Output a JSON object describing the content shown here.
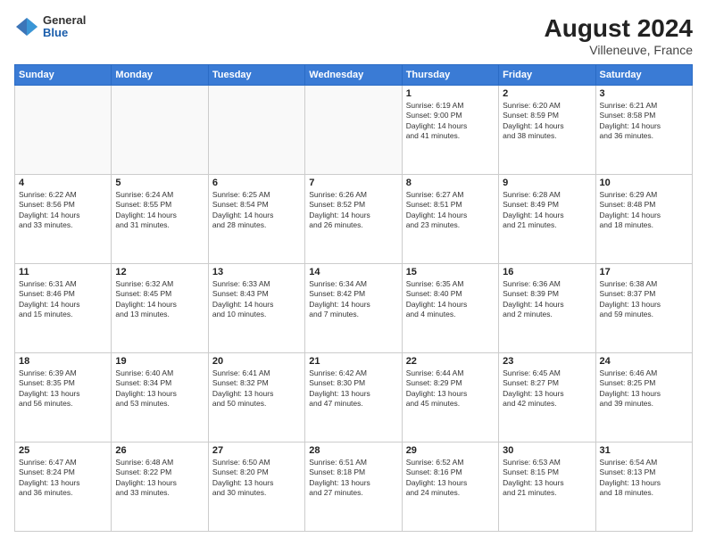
{
  "header": {
    "logo": {
      "general": "General",
      "blue": "Blue"
    },
    "title": "August 2024",
    "location": "Villeneuve, France"
  },
  "days_of_week": [
    "Sunday",
    "Monday",
    "Tuesday",
    "Wednesday",
    "Thursday",
    "Friday",
    "Saturday"
  ],
  "weeks": [
    [
      {
        "day": "",
        "info": ""
      },
      {
        "day": "",
        "info": ""
      },
      {
        "day": "",
        "info": ""
      },
      {
        "day": "",
        "info": ""
      },
      {
        "day": "1",
        "info": "Sunrise: 6:19 AM\nSunset: 9:00 PM\nDaylight: 14 hours\nand 41 minutes."
      },
      {
        "day": "2",
        "info": "Sunrise: 6:20 AM\nSunset: 8:59 PM\nDaylight: 14 hours\nand 38 minutes."
      },
      {
        "day": "3",
        "info": "Sunrise: 6:21 AM\nSunset: 8:58 PM\nDaylight: 14 hours\nand 36 minutes."
      }
    ],
    [
      {
        "day": "4",
        "info": "Sunrise: 6:22 AM\nSunset: 8:56 PM\nDaylight: 14 hours\nand 33 minutes."
      },
      {
        "day": "5",
        "info": "Sunrise: 6:24 AM\nSunset: 8:55 PM\nDaylight: 14 hours\nand 31 minutes."
      },
      {
        "day": "6",
        "info": "Sunrise: 6:25 AM\nSunset: 8:54 PM\nDaylight: 14 hours\nand 28 minutes."
      },
      {
        "day": "7",
        "info": "Sunrise: 6:26 AM\nSunset: 8:52 PM\nDaylight: 14 hours\nand 26 minutes."
      },
      {
        "day": "8",
        "info": "Sunrise: 6:27 AM\nSunset: 8:51 PM\nDaylight: 14 hours\nand 23 minutes."
      },
      {
        "day": "9",
        "info": "Sunrise: 6:28 AM\nSunset: 8:49 PM\nDaylight: 14 hours\nand 21 minutes."
      },
      {
        "day": "10",
        "info": "Sunrise: 6:29 AM\nSunset: 8:48 PM\nDaylight: 14 hours\nand 18 minutes."
      }
    ],
    [
      {
        "day": "11",
        "info": "Sunrise: 6:31 AM\nSunset: 8:46 PM\nDaylight: 14 hours\nand 15 minutes."
      },
      {
        "day": "12",
        "info": "Sunrise: 6:32 AM\nSunset: 8:45 PM\nDaylight: 14 hours\nand 13 minutes."
      },
      {
        "day": "13",
        "info": "Sunrise: 6:33 AM\nSunset: 8:43 PM\nDaylight: 14 hours\nand 10 minutes."
      },
      {
        "day": "14",
        "info": "Sunrise: 6:34 AM\nSunset: 8:42 PM\nDaylight: 14 hours\nand 7 minutes."
      },
      {
        "day": "15",
        "info": "Sunrise: 6:35 AM\nSunset: 8:40 PM\nDaylight: 14 hours\nand 4 minutes."
      },
      {
        "day": "16",
        "info": "Sunrise: 6:36 AM\nSunset: 8:39 PM\nDaylight: 14 hours\nand 2 minutes."
      },
      {
        "day": "17",
        "info": "Sunrise: 6:38 AM\nSunset: 8:37 PM\nDaylight: 13 hours\nand 59 minutes."
      }
    ],
    [
      {
        "day": "18",
        "info": "Sunrise: 6:39 AM\nSunset: 8:35 PM\nDaylight: 13 hours\nand 56 minutes."
      },
      {
        "day": "19",
        "info": "Sunrise: 6:40 AM\nSunset: 8:34 PM\nDaylight: 13 hours\nand 53 minutes."
      },
      {
        "day": "20",
        "info": "Sunrise: 6:41 AM\nSunset: 8:32 PM\nDaylight: 13 hours\nand 50 minutes."
      },
      {
        "day": "21",
        "info": "Sunrise: 6:42 AM\nSunset: 8:30 PM\nDaylight: 13 hours\nand 47 minutes."
      },
      {
        "day": "22",
        "info": "Sunrise: 6:44 AM\nSunset: 8:29 PM\nDaylight: 13 hours\nand 45 minutes."
      },
      {
        "day": "23",
        "info": "Sunrise: 6:45 AM\nSunset: 8:27 PM\nDaylight: 13 hours\nand 42 minutes."
      },
      {
        "day": "24",
        "info": "Sunrise: 6:46 AM\nSunset: 8:25 PM\nDaylight: 13 hours\nand 39 minutes."
      }
    ],
    [
      {
        "day": "25",
        "info": "Sunrise: 6:47 AM\nSunset: 8:24 PM\nDaylight: 13 hours\nand 36 minutes."
      },
      {
        "day": "26",
        "info": "Sunrise: 6:48 AM\nSunset: 8:22 PM\nDaylight: 13 hours\nand 33 minutes."
      },
      {
        "day": "27",
        "info": "Sunrise: 6:50 AM\nSunset: 8:20 PM\nDaylight: 13 hours\nand 30 minutes."
      },
      {
        "day": "28",
        "info": "Sunrise: 6:51 AM\nSunset: 8:18 PM\nDaylight: 13 hours\nand 27 minutes."
      },
      {
        "day": "29",
        "info": "Sunrise: 6:52 AM\nSunset: 8:16 PM\nDaylight: 13 hours\nand 24 minutes."
      },
      {
        "day": "30",
        "info": "Sunrise: 6:53 AM\nSunset: 8:15 PM\nDaylight: 13 hours\nand 21 minutes."
      },
      {
        "day": "31",
        "info": "Sunrise: 6:54 AM\nSunset: 8:13 PM\nDaylight: 13 hours\nand 18 minutes."
      }
    ]
  ]
}
